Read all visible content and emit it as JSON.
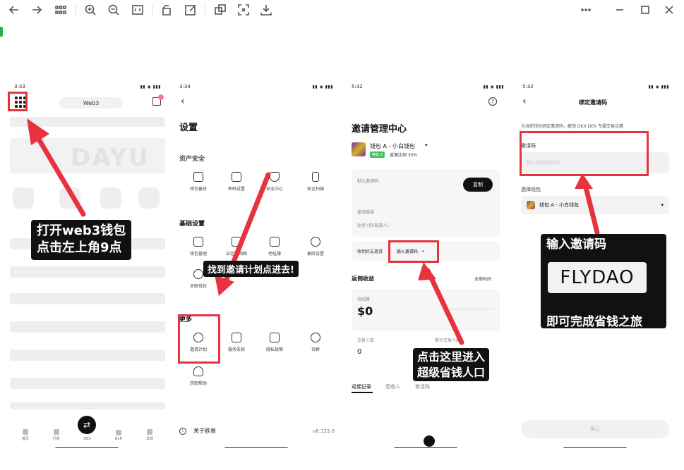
{
  "toolbar": {
    "icons": [
      "back-arrow-icon",
      "forward-arrow-icon",
      "grid-view-icon",
      "zoom-in-icon",
      "zoom-out-icon",
      "fit-page-icon",
      "rotate-icon",
      "edit-icon",
      "copy-icon",
      "fullscreen-icon",
      "download-icon",
      "more-icon",
      "minimize-icon",
      "maximize-icon",
      "close-icon"
    ]
  },
  "phone1": {
    "time": "3:33",
    "network_pill": "Web3",
    "watermark": "DAYU",
    "bottom_nav": [
      "首页",
      "行情",
      "DEX",
      "DeFi",
      "发现"
    ]
  },
  "phone2": {
    "time": "3:34",
    "title": "设置",
    "section_wallet_security": "资产安全",
    "wallet_items": [
      "钱包备份",
      "密码设置",
      "安全中心",
      "安全扫描"
    ],
    "section_basic": "基础设置",
    "basic_items": [
      "钱包管理",
      "自定义网络",
      "地址簿",
      "偏好设置",
      "关联钱包"
    ],
    "section_more": "更多",
    "more_items": [
      "邀请计划",
      "服务条款",
      "隐私政策",
      "社群",
      "获取帮助"
    ],
    "about_label": "关于欧易",
    "version": "v6.133.0"
  },
  "phone3": {
    "time": "5:32",
    "title": "邀请管理中心",
    "wallet_name": "钱包 A - 小白钱包",
    "level_badge": "等级 1",
    "rebate_ratio": "返佣比例 30%",
    "default_code_label": "默认邀请码",
    "copy_label": "复制",
    "invite_link_label": "邀请链接",
    "ratio_label": "比例 (你/被邀人)",
    "friend_code_label": "收到好友邀请",
    "enter_code_label": "输入邀请码",
    "rebate_earnings": "返佣收益",
    "time_filter": "全部时间",
    "pending_label": "待结算",
    "earnings_value": "$0",
    "trade_count_label": "交易人数",
    "trade_count_value": "0",
    "trade_users_label": "累计交易人数",
    "tabs": [
      "返佣记录",
      "受邀人",
      "邀请码"
    ]
  },
  "phone4": {
    "time": "5:32",
    "title": "绑定邀请码",
    "description": "为当前钱包绑定邀请码，解锁 OKX DEX 专属交易优惠",
    "code_label": "邀请码",
    "code_placeholder": "输入或粘贴邀请码",
    "select_wallet_label": "选择钱包",
    "selected_wallet": "钱包 A - 小白钱包",
    "confirm": "确认"
  },
  "annotations": {
    "step1": [
      "打开web3钱包",
      "点击左上角9点"
    ],
    "step2": "找到邀请计划点进去!",
    "step3": [
      "点击这里进入",
      "超级省钱人口"
    ],
    "step4_title": "输入邀请码",
    "step4_code": "FLYDAO",
    "step4_footer": "即可完成省钱之旅"
  },
  "colors": {
    "annotation_red": "#e8323d",
    "annotation_bg": "#111111",
    "level_green": "#3fc356"
  }
}
